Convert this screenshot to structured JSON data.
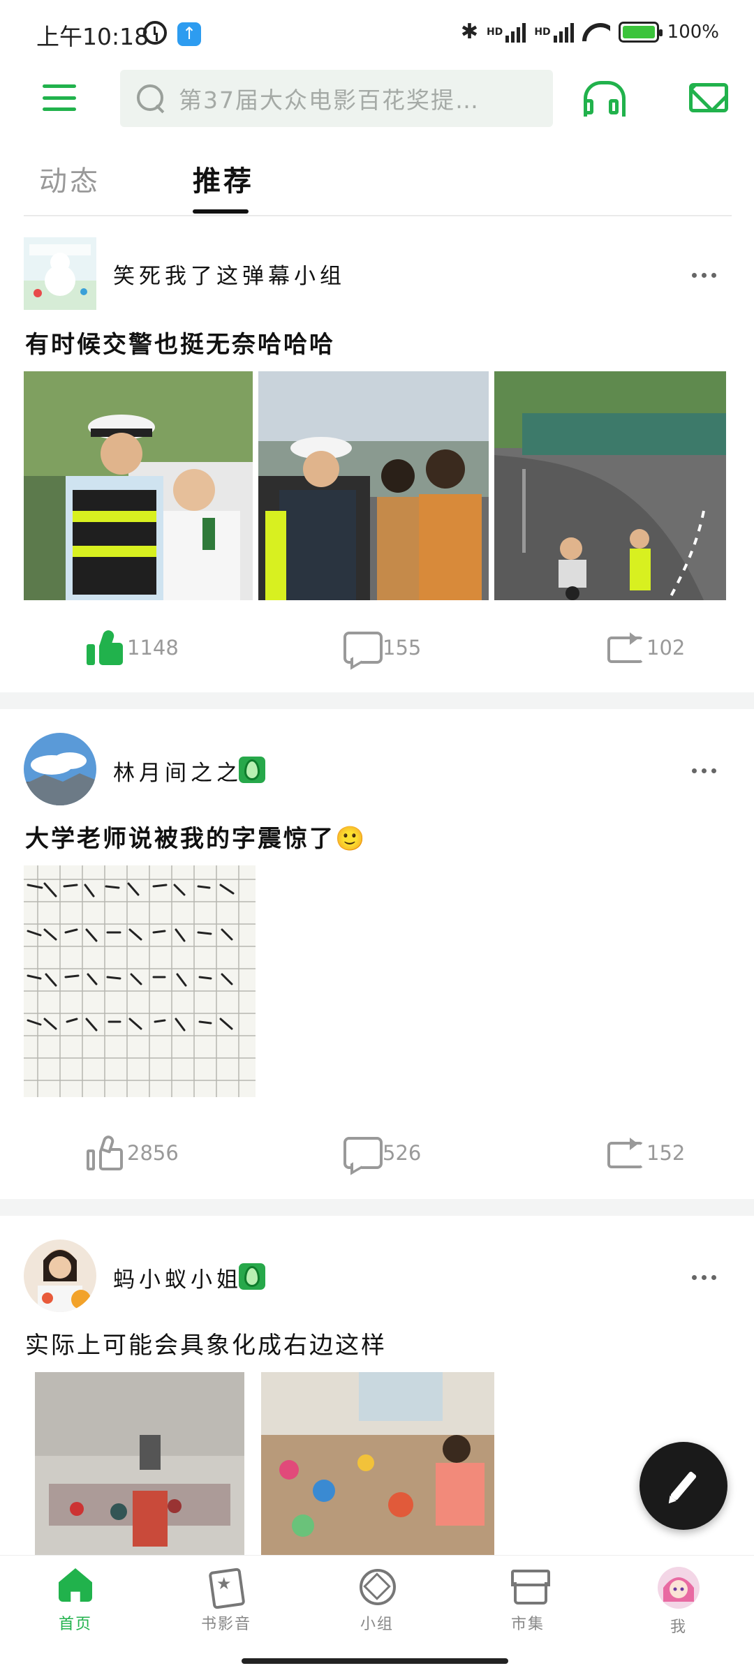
{
  "status_bar": {
    "time": "上午10:18",
    "hd1": "HD",
    "hd2": "HD",
    "battery": "100%"
  },
  "header": {
    "search_placeholder": "第37届大众电影百花奖提…"
  },
  "tabs": [
    {
      "label": "动态",
      "active": false
    },
    {
      "label": "推荐",
      "active": true
    }
  ],
  "posts": [
    {
      "author": "笑死我了这弹幕小组",
      "title": "有时候交警也挺无奈哈哈哈",
      "likes": "1148",
      "comments": "155",
      "reposts": "102",
      "liked": true
    },
    {
      "author": "林月间之之",
      "title": "大学老师说被我的字震惊了🙂",
      "likes": "2856",
      "comments": "526",
      "reposts": "152",
      "liked": false
    },
    {
      "author": "蚂小蚁小姐",
      "title": "实际上可能会具象化成右边这样"
    }
  ],
  "bottom_nav": [
    {
      "label": "首页",
      "icon": "home-icon",
      "active": true
    },
    {
      "label": "书影音",
      "icon": "book-movie-music-icon",
      "active": false
    },
    {
      "label": "小组",
      "icon": "group-icon",
      "active": false
    },
    {
      "label": "市集",
      "icon": "market-icon",
      "active": false
    },
    {
      "label": "我",
      "icon": "profile-avatar",
      "active": false
    }
  ],
  "colors": {
    "accent": "#21b24c",
    "text_muted": "#999999",
    "fab": "#1a1a1a"
  }
}
